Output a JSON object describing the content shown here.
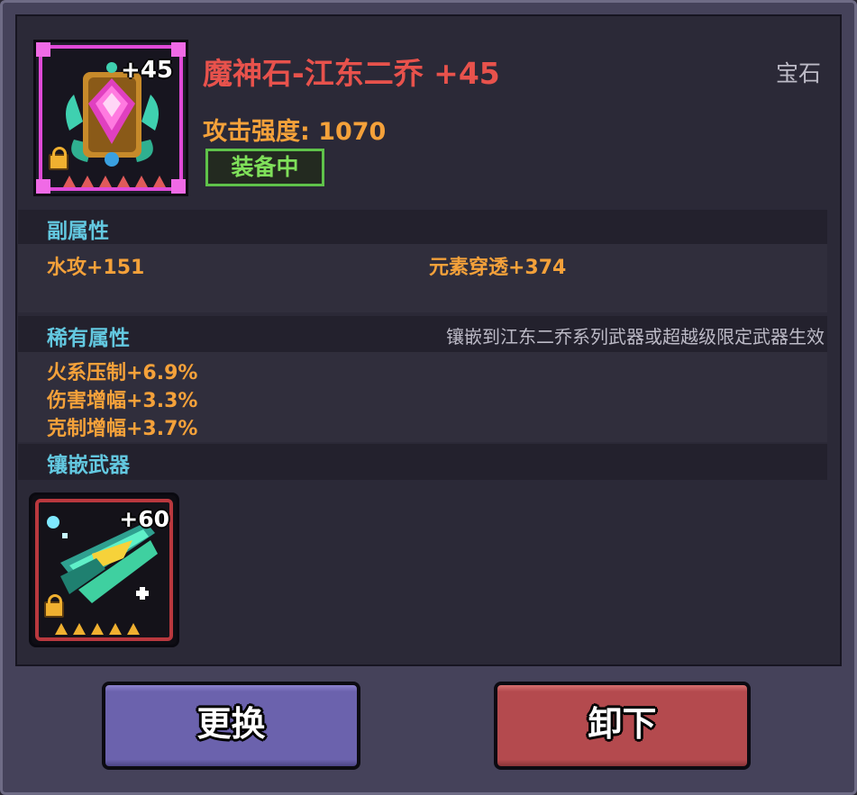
{
  "gem": {
    "level_badge": "+45",
    "name": "魔神石-江东二乔 +45",
    "type": "宝石",
    "attack": "攻击强度: 1070",
    "equipped_badge": "装备中",
    "stars": 6
  },
  "sub_attributes": {
    "title": "副属性",
    "items": [
      "水攻+151",
      "元素穿透+374"
    ]
  },
  "rare_attributes": {
    "title": "稀有属性",
    "hint": "镶嵌到江东二乔系列武器或超越级限定武器生效",
    "items": [
      "火系压制+6.9%",
      "伤害增幅+3.3%",
      "克制增幅+3.7%"
    ]
  },
  "inlaid_weapon": {
    "title": "镶嵌武器",
    "level_badge": "+60",
    "stars": 5
  },
  "buttons": {
    "replace": "更换",
    "remove": "卸下"
  },
  "colors": {
    "title_red": "#e8524c",
    "value_orange": "#f4a13a",
    "section_cyan": "#63c8e0",
    "equipped_green": "#5fc24a",
    "replace_purple": "#6b62ad",
    "remove_red": "#b44a4e"
  }
}
